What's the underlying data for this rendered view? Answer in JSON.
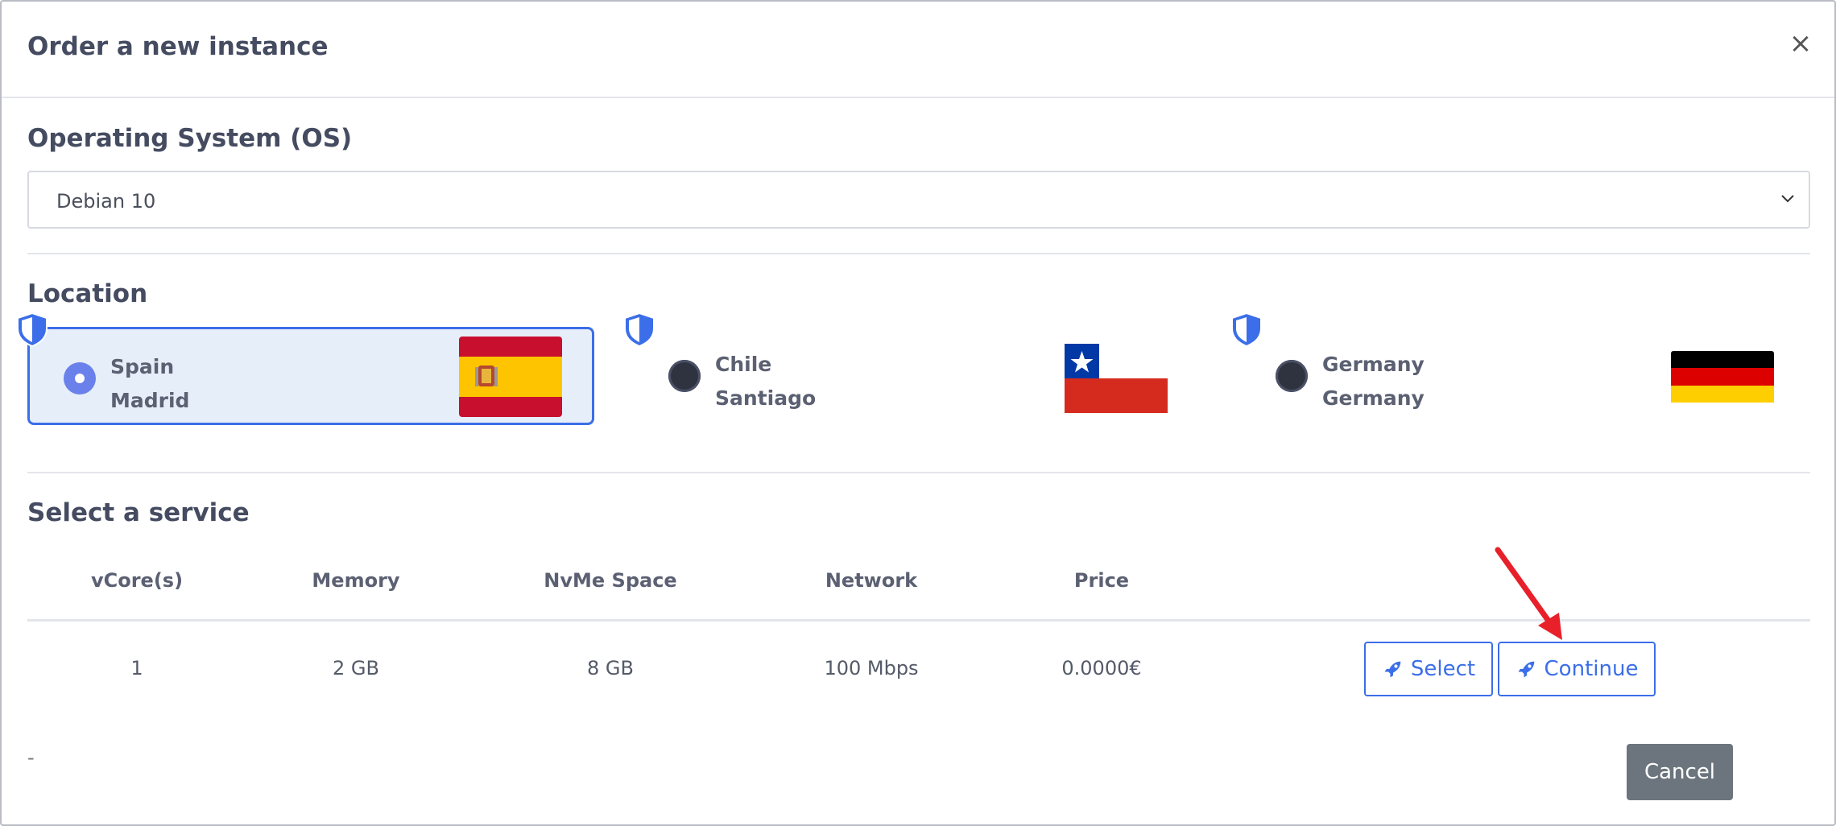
{
  "modal": {
    "title": "Order a new instance",
    "close_label": "×"
  },
  "os": {
    "section_title": "Operating System (OS)",
    "selected": "Debian 10"
  },
  "location": {
    "section_title": "Location",
    "options": [
      {
        "country": "Spain",
        "city": "Madrid",
        "flag": "spain-flag",
        "selected": true
      },
      {
        "country": "Chile",
        "city": "Santiago",
        "flag": "chile-flag",
        "selected": false
      },
      {
        "country": "Germany",
        "city": "Germany",
        "flag": "germany-flag",
        "selected": false
      }
    ]
  },
  "service": {
    "section_title": "Select a service",
    "columns": [
      "vCore(s)",
      "Memory",
      "NvMe Space",
      "Network",
      "Price"
    ],
    "rows": [
      {
        "vcores": "1",
        "memory": "2 GB",
        "nvme": "8 GB",
        "network": "100 Mbps",
        "price": "0.0000€"
      }
    ],
    "select_label": "Select",
    "continue_label": "Continue"
  },
  "footer": {
    "dash": "-",
    "cancel_label": "Cancel"
  },
  "colors": {
    "accent": "#3b6ee8",
    "cancel": "#6c757d",
    "arrow": "#e8202a"
  }
}
